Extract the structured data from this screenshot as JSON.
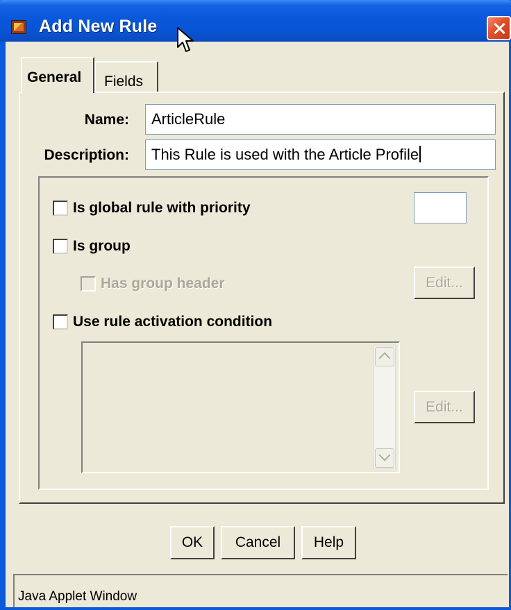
{
  "window": {
    "title": "Add New Rule"
  },
  "tabs": [
    {
      "label": "General",
      "selected": true
    },
    {
      "label": "Fields",
      "selected": false
    }
  ],
  "form": {
    "name_label": "Name:",
    "name_value": "ArticleRule",
    "description_label": "Description:",
    "description_value": "This Rule is used with the Article Profile"
  },
  "options": {
    "global_rule_label": "Is global rule with priority",
    "global_rule_checked": false,
    "priority_value": "",
    "is_group_label": "Is group",
    "is_group_checked": false,
    "has_group_header_label": "Has group header",
    "has_group_header_checked": false,
    "has_group_header_enabled": false,
    "group_header_edit_label": "Edit...",
    "activation_label": "Use rule activation condition",
    "activation_checked": false,
    "activation_text": "",
    "activation_edit_label": "Edit..."
  },
  "buttons": {
    "ok": "OK",
    "cancel": "Cancel",
    "help": "Help"
  },
  "status_bar": {
    "text": "Java Applet Window"
  },
  "colors": {
    "titlebar": "#0A59DA",
    "dialog_bg": "#ECE9D8",
    "input_border": "#7F9DB9",
    "disabled_text": "#ACA899",
    "close_button": "#E0502A"
  }
}
